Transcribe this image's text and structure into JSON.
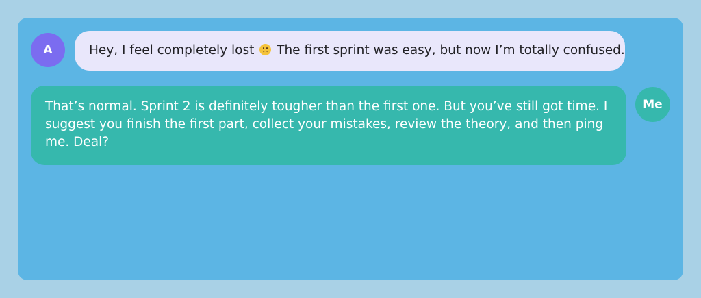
{
  "chat": {
    "messages": [
      {
        "sender_initial": "A",
        "text_before_emoji": "Hey, I feel completely lost",
        "emoji_name": "slightly-frowning-face-icon",
        "text_after_emoji": "The first sprint was easy, but now I’m totally confused."
      },
      {
        "sender_initial": "Me",
        "text": "That’s normal. Sprint 2 is definitely tougher than the first one. But you’ve still got time. I suggest you finish the first part, collect your mistakes, review the theory, and then ping me. Deal?"
      }
    ]
  },
  "colors": {
    "page_background": "#a9d1e6",
    "chat_background": "#5cb5e4",
    "avatar_a": "#7b6cf0",
    "avatar_me": "#36b8ad",
    "incoming_bubble": "#e9e7fb",
    "outgoing_bubble": "#36b8ad"
  }
}
